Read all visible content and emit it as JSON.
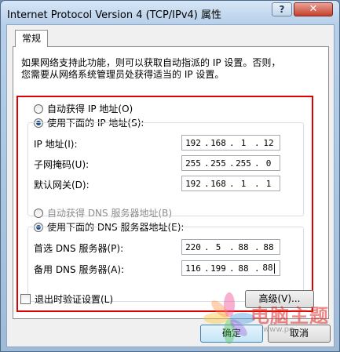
{
  "window": {
    "title": "Internet Protocol Version 4 (TCP/IPv4) 属性",
    "help_label": "?",
    "close_label": "✕"
  },
  "tab": {
    "label": "常规"
  },
  "description_line1": "如果网络支持此功能，则可以获取自动指派的 IP 设置。否则，",
  "description_line2": "您需要从网络系统管理员处获得适当的 IP 设置。",
  "ip": {
    "auto_label": "自动获得 IP 地址(O)",
    "manual_label": "使用下面的 IP 地址(S):",
    "selected": "manual",
    "fields": [
      {
        "label": "IP 地址(I):",
        "octets": [
          "192",
          "168",
          "1",
          "12"
        ]
      },
      {
        "label": "子网掩码(U):",
        "octets": [
          "255",
          "255",
          "255",
          "0"
        ]
      },
      {
        "label": "默认网关(D):",
        "octets": [
          "192",
          "168",
          "1",
          "1"
        ]
      }
    ]
  },
  "dns": {
    "auto_label": "自动获得 DNS 服务器地址(B)",
    "manual_label": "使用下面的 DNS 服务器地址(E):",
    "selected": "manual",
    "fields": [
      {
        "label": "首选 DNS 服务器(P):",
        "octets": [
          "220",
          "5",
          "88",
          "88"
        ]
      },
      {
        "label": "备用 DNS 服务器(A):",
        "octets": [
          "116",
          "199",
          "88",
          "88"
        ]
      }
    ]
  },
  "validate_label": "退出时验证设置(L)",
  "advanced_label": "高级(V)...",
  "ok_label": "确定",
  "cancel_label": "取消",
  "watermark": {
    "text": "电脑主题",
    "url": "www.pc..."
  },
  "colors": {
    "highlight_border": "#e00000",
    "accent": "#1a4f94"
  }
}
